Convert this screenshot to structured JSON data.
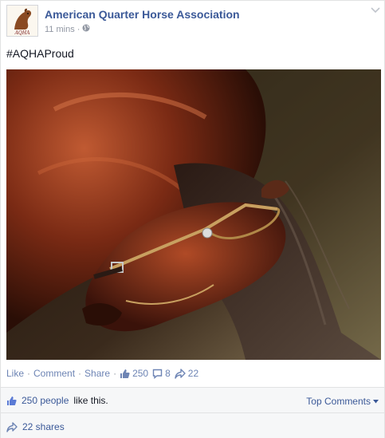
{
  "post": {
    "page_name": "American Quarter Horse Association",
    "avatar_text": "AQHA",
    "timestamp": "11 mins",
    "dot": "·",
    "audience_icon": "globe-icon",
    "menu_icon": "chevron-down-icon",
    "text": "#AQHAProud",
    "photo_alt": "horse-photo"
  },
  "actions": {
    "like": "Like",
    "comment": "Comment",
    "share": "Share",
    "separator": "·",
    "like_count": "250",
    "comment_count": "8",
    "share_count": "22"
  },
  "feedback": {
    "likes_count_text": "250 people",
    "likes_suffix": "like this.",
    "top_comments": "Top Comments",
    "shares_text": "22 shares"
  },
  "colors": {
    "link_blue": "#3b5998",
    "action_blue": "#6d84b4",
    "muted_gray": "#9197a3",
    "feedback_bg": "#f6f7f8"
  }
}
